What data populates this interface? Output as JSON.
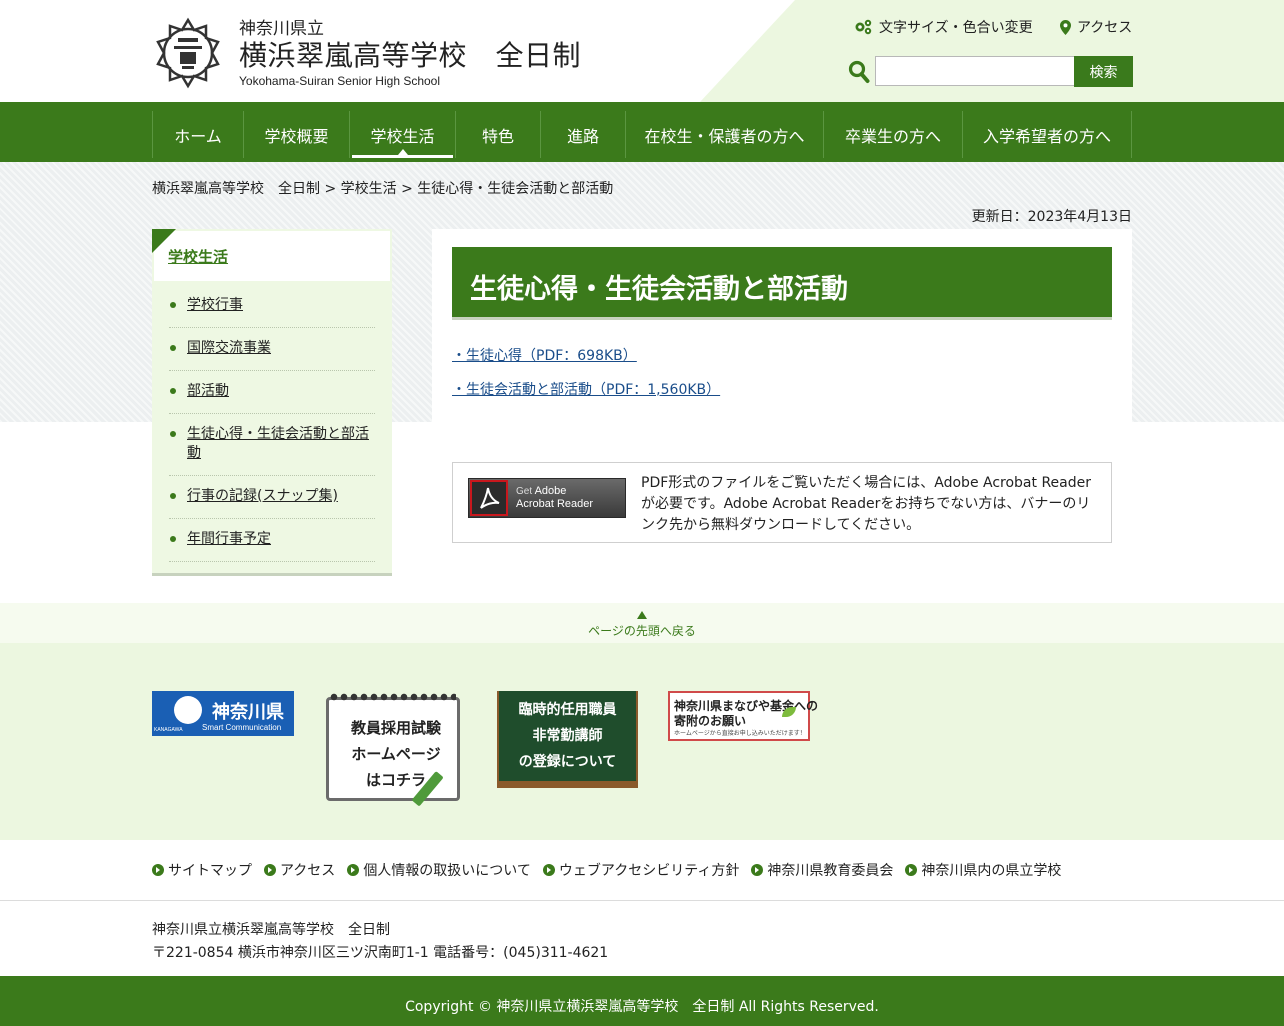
{
  "header": {
    "prefecture": "神奈川県立",
    "school_name": "横浜翠嵐高等学校　全日制",
    "school_name_en": "Yokohama-Suiran Senior High School",
    "text_size_label": "文字サイズ・色合い変更",
    "access_label": "アクセス",
    "search_placeholder": "",
    "search_button": "検索"
  },
  "nav": {
    "items": [
      "ホーム",
      "学校概要",
      "学校生活",
      "特色",
      "進路",
      "在校生・保護者の方へ",
      "卒業生の方へ",
      "入学希望者の方へ"
    ],
    "active_index": 2
  },
  "breadcrumb": "横浜翠嵐高等学校　全日制 > 学校生活 > 生徒心得・生徒会活動と部活動",
  "updated": "更新日：2023年4月13日",
  "sidebar": {
    "title": "学校生活",
    "items": [
      "学校行事",
      "国際交流事業",
      "部活動",
      "生徒心得・生徒会活動と部活動",
      "行事の記録(スナップ集)",
      "年間行事予定"
    ]
  },
  "content": {
    "title": "生徒心得・生徒会活動と部活動",
    "links": [
      "・生徒心得（PDF：698KB）",
      "・生徒会活動と部活動（PDF：1,560KB）"
    ],
    "acrobat_get": "Get",
    "acrobat_name1": "Adobe",
    "acrobat_name2": "Acrobat Reader",
    "acrobat_text": "PDF形式のファイルをご覧いただく場合には、Adobe Acrobat Readerが必要です。Adobe Acrobat Readerをお持ちでない方は、バナーのリンク先から無料ダウンロードしてください。"
  },
  "pagetop": "ページの先頭へ戻る",
  "banners": {
    "kanagawa_name": "神奈川県",
    "kanagawa_sub": "Smart Communication",
    "kanagawa_small": "KANAGAWA",
    "teacher_lines": [
      "教員採用試験",
      "ホームページ",
      "はコチラ"
    ],
    "temp_lines": [
      "臨時的任用職員",
      "非常勤講師",
      "の登録について"
    ],
    "manabi_line1": "神奈川県まなびや基金への",
    "manabi_line2": "寄附のお願い",
    "manabi_line3": "ホームページから直接お申し込みいただけます！"
  },
  "footer": {
    "links": [
      "サイトマップ",
      "アクセス",
      "個人情報の取扱いについて",
      "ウェブアクセシビリティ方針",
      "神奈川県教育委員会",
      "神奈川県内の県立学校"
    ],
    "address_line1": "神奈川県立横浜翠嵐高等学校　全日制",
    "address_line2": "〒221-0854 横浜市神奈川区三ツ沢南町1-1 電話番号：(045)311-4621",
    "copyright": "Copyright © 神奈川県立横浜翠嵐高等学校　全日制 All Rights Reserved."
  },
  "colors": {
    "brand": "#3b7a1b",
    "light_green": "#ecf7e0",
    "link": "#1a4d8a"
  }
}
